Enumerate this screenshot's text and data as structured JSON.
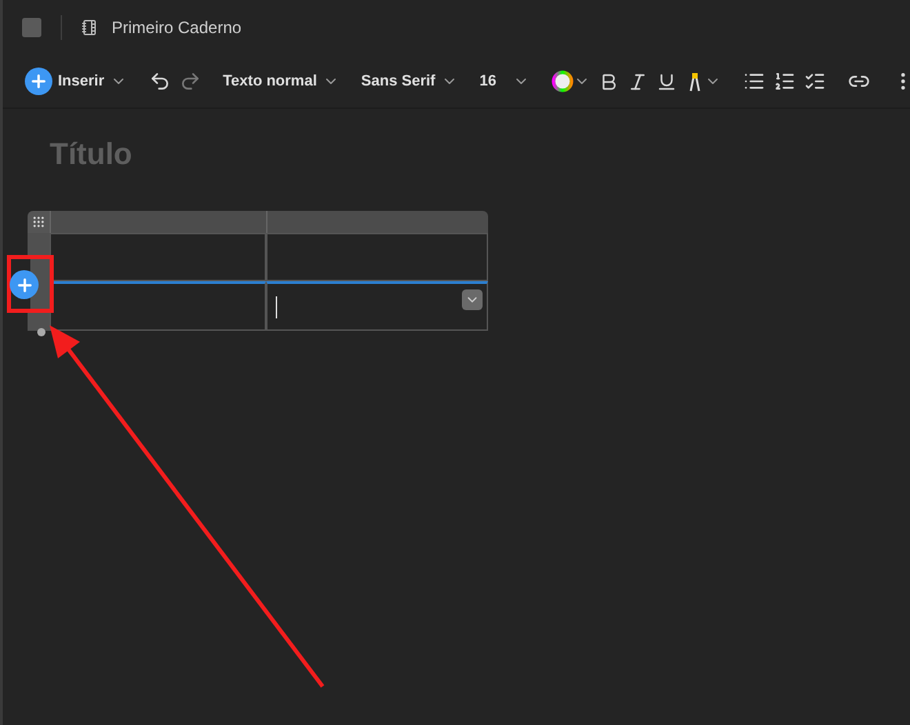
{
  "window": {
    "title": "Primeiro Caderno"
  },
  "toolbar": {
    "insert": "Inserir",
    "style": "Texto normal",
    "font": "Sans Serif",
    "size": "16"
  },
  "document": {
    "title_placeholder": "Título"
  },
  "table": {
    "rows": [
      {
        "cells": [
          {
            "active": false
          },
          {
            "active": false
          }
        ]
      },
      {
        "cells": [
          {
            "active": false
          },
          {
            "active": true
          }
        ]
      }
    ]
  }
}
